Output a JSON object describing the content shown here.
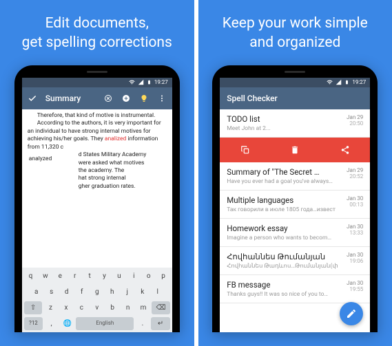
{
  "left": {
    "headline": "Edit documents,\nget spelling corrections",
    "status": {
      "time": "19:27"
    },
    "appbar": {
      "title": "Summary"
    },
    "doc": {
      "line1": "Therefore, that kind of motive is instrumental.",
      "para_pre": "According to the authors, it is very important for an individual to have strong internal motives for achieving his/her goals. They ",
      "spell_error": "analized",
      "para_mid": " information from 11,320 c",
      "correction": "analyzed",
      "para_tail_1": "d States Military Academy",
      "para_tail_2": "were asked what motives",
      "para_tail_3": "the academy. The",
      "para_tail_4": "hat strong internal",
      "para_tail_5": "gher graduation rates."
    },
    "keyboard": {
      "row1": [
        "q",
        "w",
        "e",
        "r",
        "t",
        "y",
        "u",
        "i",
        "o",
        "p"
      ],
      "row2": [
        "a",
        "s",
        "d",
        "f",
        "g",
        "h",
        "j",
        "k",
        "l"
      ],
      "row3_shift": "⇧",
      "row3": [
        "z",
        "x",
        "c",
        "v",
        "b",
        "n",
        "m"
      ],
      "row3_del": "⌫",
      "row4_nums": "?12",
      "row4_comma": ",",
      "row4_globe": "🌐",
      "space_label": "English",
      "row4_period": ".",
      "row4_enter": "↵"
    }
  },
  "right": {
    "headline": "Keep your work simple\nand organized",
    "status": {
      "time": "19:27"
    },
    "appbar": {
      "title": "Spell Checker"
    },
    "items": [
      {
        "title": "TODO list",
        "preview": "Meet John at 2...",
        "date": "Jan 29",
        "time": "20:50"
      },
      {
        "title": "Summary of \"The Secret …",
        "preview": "Have you ever had a goal you've always…",
        "date": "Jan 29",
        "time": "20:52"
      },
      {
        "title": "Multiple languages",
        "preview": "Так говорили в июле 1805 года…извест",
        "date": "Jan 30",
        "time": "00:13"
      },
      {
        "title": "Homework essay",
        "preview": "Imagine a person who wants to becom…",
        "date": "Jan 30",
        "time": "13:33"
      },
      {
        "title": "Հովհաննես Թումանյան",
        "preview": "Հովհաննես Թադևոս…Թումանյան(փ",
        "date": "Jan 30",
        "time": "19:06"
      },
      {
        "title": "FB message",
        "preview": "Thanks guys!! It was so nice of you to…",
        "date": "Jan 30",
        "time": "19:55"
      }
    ]
  }
}
